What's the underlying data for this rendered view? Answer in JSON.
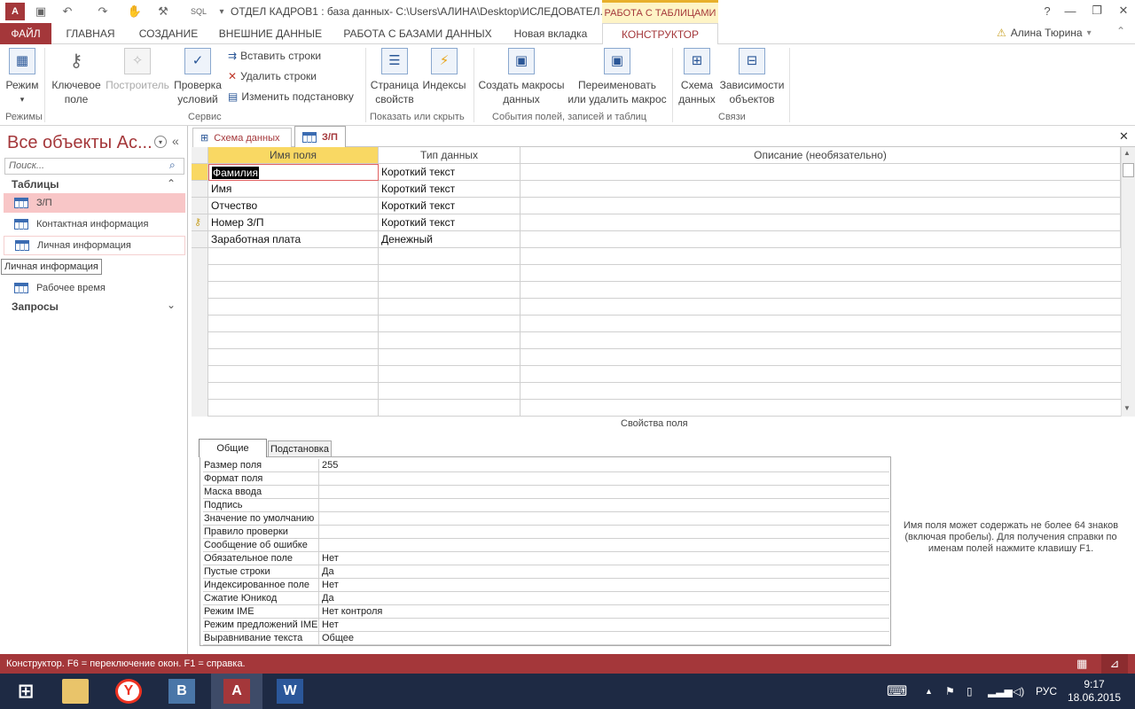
{
  "window": {
    "title": "ОТДЕЛ КАДРОВ1 : база данных- C:\\Users\\АЛИНА\\Desktop\\ИСЛЕДОВАТЕЛ...",
    "context_group": "РАБОТА С ТАБЛИЦАМИ",
    "app_icon": "A",
    "quick_access_sql": "SQL",
    "help": "?",
    "minimize": "—",
    "restore": "❐",
    "close": "✕"
  },
  "tabs": [
    "ФАЙЛ",
    "ГЛАВНАЯ",
    "СОЗДАНИЕ",
    "ВНЕШНИЕ ДАННЫЕ",
    "РАБОТА С БАЗАМИ ДАННЫХ",
    "Новая вкладка",
    "КОНСТРУКТОР"
  ],
  "user": {
    "name": "Алина Тюрина",
    "warning": "⚠",
    "dropdown": "▾"
  },
  "ribbon": {
    "mode": {
      "line1": "Режим",
      "arrow": "▾"
    },
    "key_field": {
      "line1": "Ключевое",
      "line2": "поле"
    },
    "builder": {
      "line1": "Построитель"
    },
    "test_rules": {
      "line1": "Проверка",
      "line2": "условий"
    },
    "insert_rows": "Вставить строки",
    "delete_rows": "Удалить строки",
    "modify_lookups": "Изменить подстановку",
    "property_sheet": {
      "line1": "Страница",
      "line2": "свойств"
    },
    "indexes": {
      "line1": "Индексы"
    },
    "create_macros": {
      "line1": "Создать макросы",
      "line2": "данных"
    },
    "rename_macro": {
      "line1": "Переименовать",
      "line2": "или удалить макрос"
    },
    "relationships": {
      "line1": "Схема",
      "line2": "данных"
    },
    "dependencies": {
      "line1": "Зависимости",
      "line2": "объектов"
    },
    "groups": {
      "modes": "Режимы",
      "tools": "Сервис",
      "show_hide": "Показать или скрыть",
      "events": "События полей, записей и таблиц",
      "relations": "Связи"
    }
  },
  "nav": {
    "title": "Все объекты Ac...",
    "search_placeholder": "Поиск...",
    "tables_header": "Таблицы",
    "tables": [
      "З/П",
      "Контактная информация",
      "Личная информация",
      "Рабочее время"
    ],
    "queries_header": "Запросы",
    "tooltip": "Личная информация",
    "collapse_up": "⌃",
    "collapse_down": "⌄",
    "pane_collapse": "«"
  },
  "doc_tabs": {
    "tab1": "Схема данных",
    "tab2": "З/П",
    "close": "✕"
  },
  "grid": {
    "headers": {
      "name": "Имя поля",
      "type": "Тип данных",
      "desc": "Описание (необязательно)"
    },
    "rows": [
      {
        "name": "Фамилия",
        "type": "Короткий текст"
      },
      {
        "name": "Имя",
        "type": "Короткий текст"
      },
      {
        "name": "Отчество",
        "type": "Короткий текст"
      },
      {
        "name": "Номер З/П",
        "type": "Короткий текст"
      },
      {
        "name": "Заработная плата",
        "type": "Денежный"
      }
    ]
  },
  "field_props": {
    "label": "Свойства поля",
    "tab_general": "Общие",
    "tab_lookup": "Подстановка",
    "rows": [
      {
        "label": "Размер поля",
        "value": "255"
      },
      {
        "label": "Формат поля",
        "value": ""
      },
      {
        "label": "Маска ввода",
        "value": ""
      },
      {
        "label": "Подпись",
        "value": ""
      },
      {
        "label": "Значение по умолчанию",
        "value": ""
      },
      {
        "label": "Правило проверки",
        "value": ""
      },
      {
        "label": "Сообщение об ошибке",
        "value": ""
      },
      {
        "label": "Обязательное поле",
        "value": "Нет"
      },
      {
        "label": "Пустые строки",
        "value": "Да"
      },
      {
        "label": "Индексированное поле",
        "value": "Нет"
      },
      {
        "label": "Сжатие Юникод",
        "value": "Да"
      },
      {
        "label": "Режим IME",
        "value": "Нет контроля"
      },
      {
        "label": "Режим предложений IME",
        "value": "Нет"
      },
      {
        "label": "Выравнивание текста",
        "value": "Общее"
      }
    ],
    "help": "Имя поля может содержать не более 64 знаков (включая пробелы). Для получения справки по именам полей нажмите клавишу F1."
  },
  "status": {
    "text": "Конструктор.  F6 = переключение окон.  F1 = справка."
  },
  "taskbar": {
    "lang": "РУС",
    "time": "9:17",
    "date": "18.06.2015",
    "word_label": "W",
    "vk_label": "B",
    "access_label": "A"
  },
  "colors": {
    "accent": "#a4373a",
    "context": "#fef4c6",
    "taskbar": "#1e2a44"
  }
}
